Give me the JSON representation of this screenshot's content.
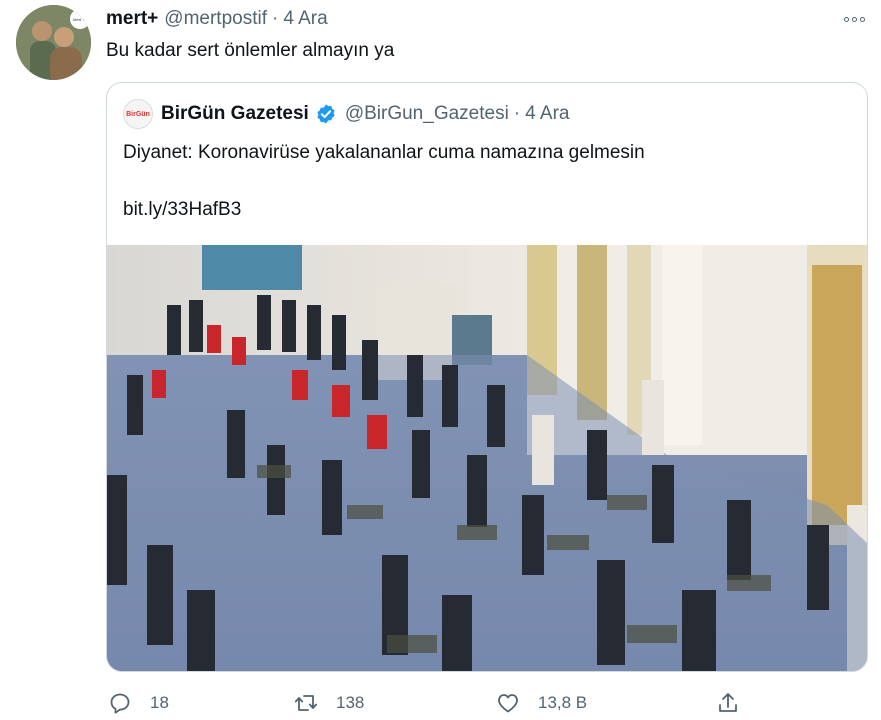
{
  "tweet": {
    "author_name": "mert+",
    "author_handle": "@mertpostif",
    "separator": "·",
    "time": "4 Ara",
    "text": "Bu kadar sert önlemler almayın ya",
    "avatar_badge": "Mert Ya"
  },
  "quote": {
    "author_name": "BirGün Gazetesi",
    "author_handle": "@BirGun_Gazetesi",
    "separator": "·",
    "time": "4 Ara",
    "avatar_text": "BirGün",
    "text": "Diyanet: Koronavirüse yakalananlar cuma namazına gelmesin",
    "link": "bit.ly/33HafB3"
  },
  "actions": {
    "reply_count": "18",
    "retweet_count": "138",
    "like_count": "13,8 B"
  },
  "colors": {
    "text": "#0f1419",
    "muted": "#536471",
    "verified": "#1d9bf0",
    "border": "#cfd9de"
  },
  "icons": [
    "more-icon",
    "verified-icon",
    "reply-icon",
    "retweet-icon",
    "like-icon",
    "share-icon"
  ]
}
